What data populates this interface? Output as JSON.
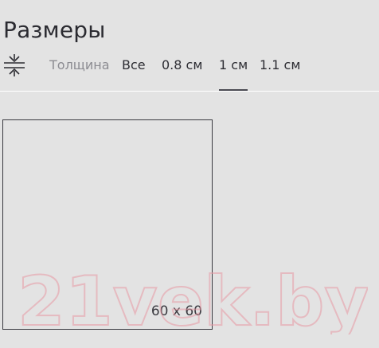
{
  "section": {
    "title": "Размеры"
  },
  "filters": {
    "icon": "thickness-icon",
    "label": "Толщина",
    "options": [
      {
        "label": "Все",
        "active": false
      },
      {
        "label": "0.8 см",
        "active": false
      },
      {
        "label": "1 см",
        "active": true
      },
      {
        "label": "1.1 см",
        "active": false
      }
    ]
  },
  "tiles": [
    {
      "size_label": "60 x 60"
    }
  ],
  "watermark": {
    "text": "21vek.by"
  },
  "colors": {
    "background": "#e3e3e3",
    "text": "#2d2d33",
    "muted": "#8c8c92",
    "watermark": "#e89aa4"
  }
}
